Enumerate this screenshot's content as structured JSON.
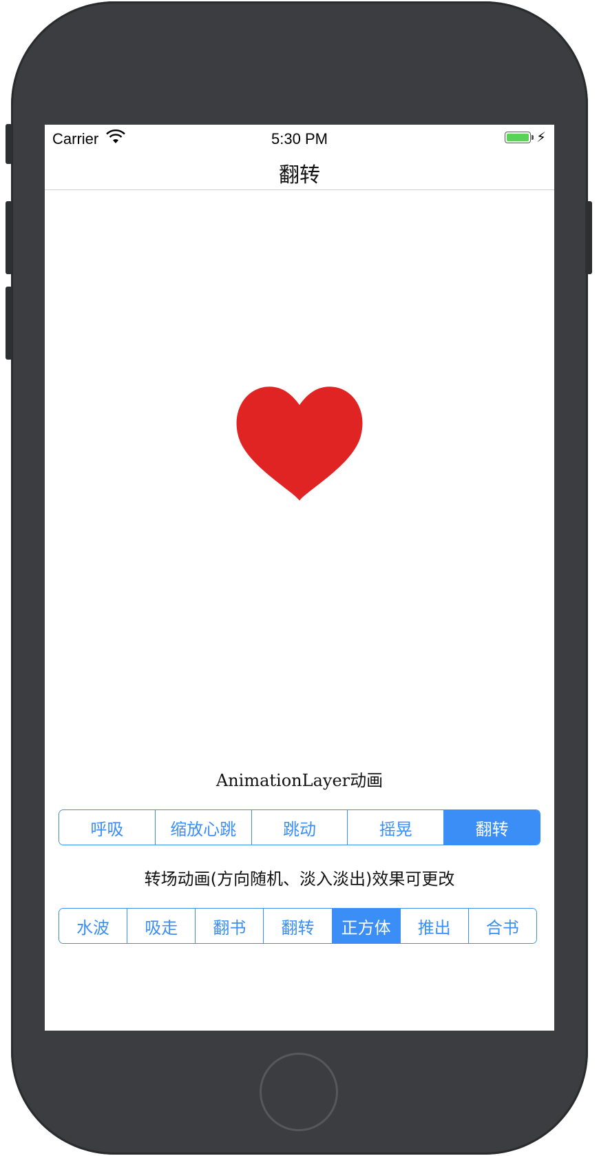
{
  "status_bar": {
    "carrier": "Carrier",
    "time": "5:30 PM",
    "icons": [
      "wifi-icon",
      "battery-icon",
      "charging-bolt-icon"
    ]
  },
  "nav": {
    "title": "翻转"
  },
  "heart": {
    "icon": "heart-icon",
    "color": "#e02424"
  },
  "animation_layer": {
    "label": "AnimationLayer动画",
    "selected_index": 4,
    "segments": [
      "呼吸",
      "缩放心跳",
      "跳动",
      "摇晃",
      "翻转"
    ]
  },
  "transition": {
    "label": "转场动画(方向随机、淡入淡出)效果可更改",
    "selected_index": 4,
    "segments": [
      "水波",
      "吸走",
      "翻书",
      "翻转",
      "正方体",
      "推出",
      "合书"
    ]
  },
  "colors": {
    "accent": "#3a8ef5",
    "heart": "#e02424",
    "battery": "#5bd15b"
  }
}
